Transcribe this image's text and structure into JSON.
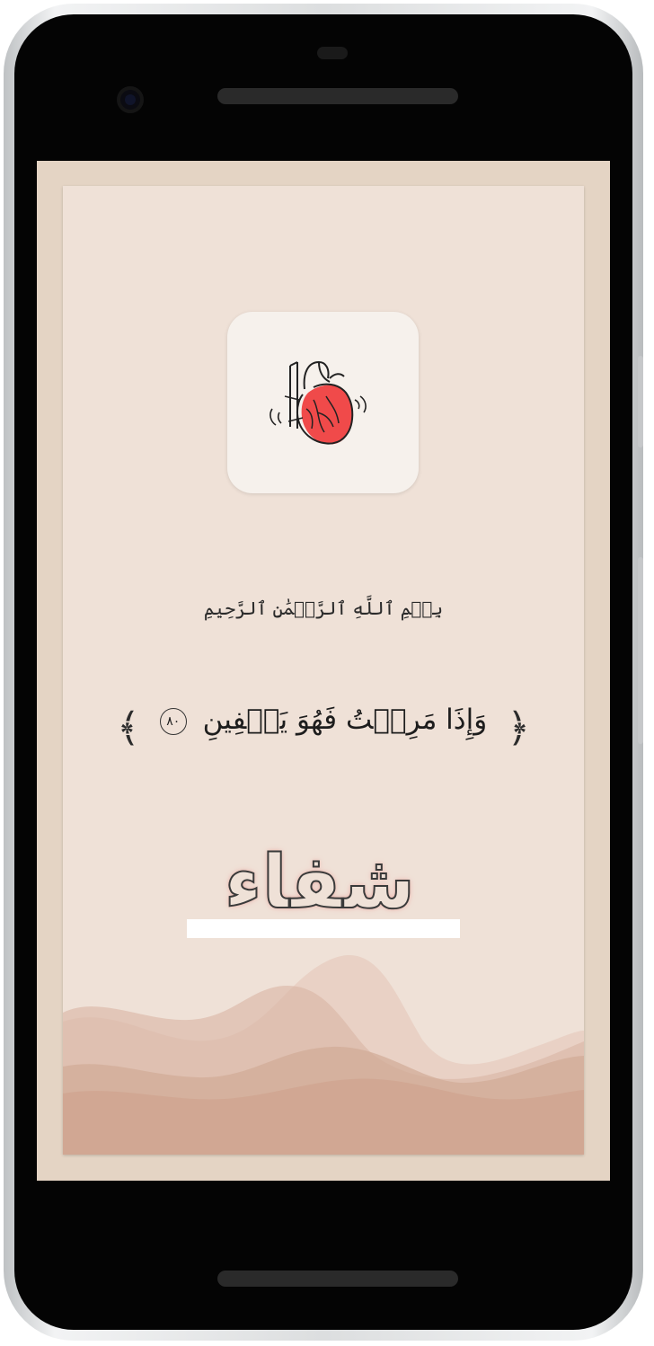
{
  "screen": {
    "app_icon": "heart-icon",
    "basmala": "بِسۡمِ ٱللَّهِ ٱلرَّحۡمَٰنِ ٱلرَّحِيمِ",
    "ayah": {
      "text": "وَإِذَا مَرِضۡتُ فَهُوَ يَشۡفِينِ",
      "number": "٨٠",
      "open_bracket": "﴿",
      "close_bracket": "﴾"
    },
    "logo_text": "شفاء"
  },
  "colors": {
    "screen_bg": "#e4d4c4",
    "card_bg": "#efe1d7",
    "heart_red": "#f04a4a",
    "wave": "#d1a995"
  }
}
